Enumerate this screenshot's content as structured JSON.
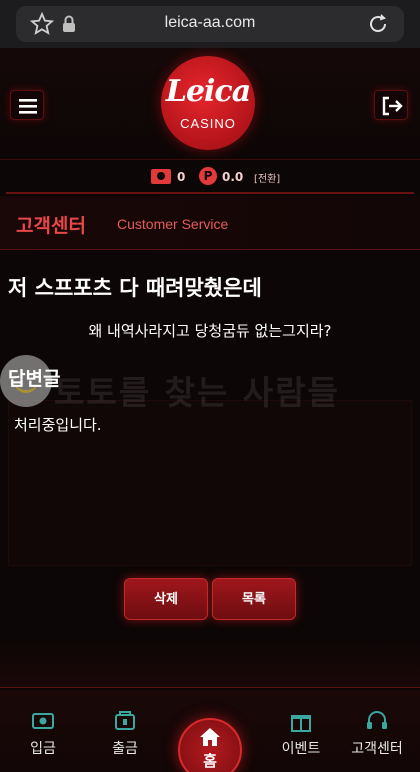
{
  "browser": {
    "url": "leica-aa.com"
  },
  "header": {
    "logo_script": "Leica",
    "logo_sub": "CASINO"
  },
  "balance": {
    "cash": "0",
    "point_symbol": "P",
    "point": "0.0",
    "exchange": "[전환]"
  },
  "section": {
    "title_ko": "고객센터",
    "title_en": "Customer Service"
  },
  "post": {
    "title": "저 스프포츠 다 때려맞췄은데",
    "body": "왜 내역사라지고 당청굼듀 없는그지라?",
    "answer_label": "답변글",
    "answer_text": "처리중입니다."
  },
  "watermark": {
    "text": "토토를 찾는 사람들"
  },
  "buttons": {
    "delete": "삭제",
    "list": "목록"
  },
  "bottom_nav": {
    "deposit": "입금",
    "withdraw": "출금",
    "home": "홈",
    "event": "이벤트",
    "support": "고객센터"
  },
  "colors": {
    "accent": "#e8474a",
    "button": "#a0171c",
    "icon_teal": "#3aa8a0"
  }
}
